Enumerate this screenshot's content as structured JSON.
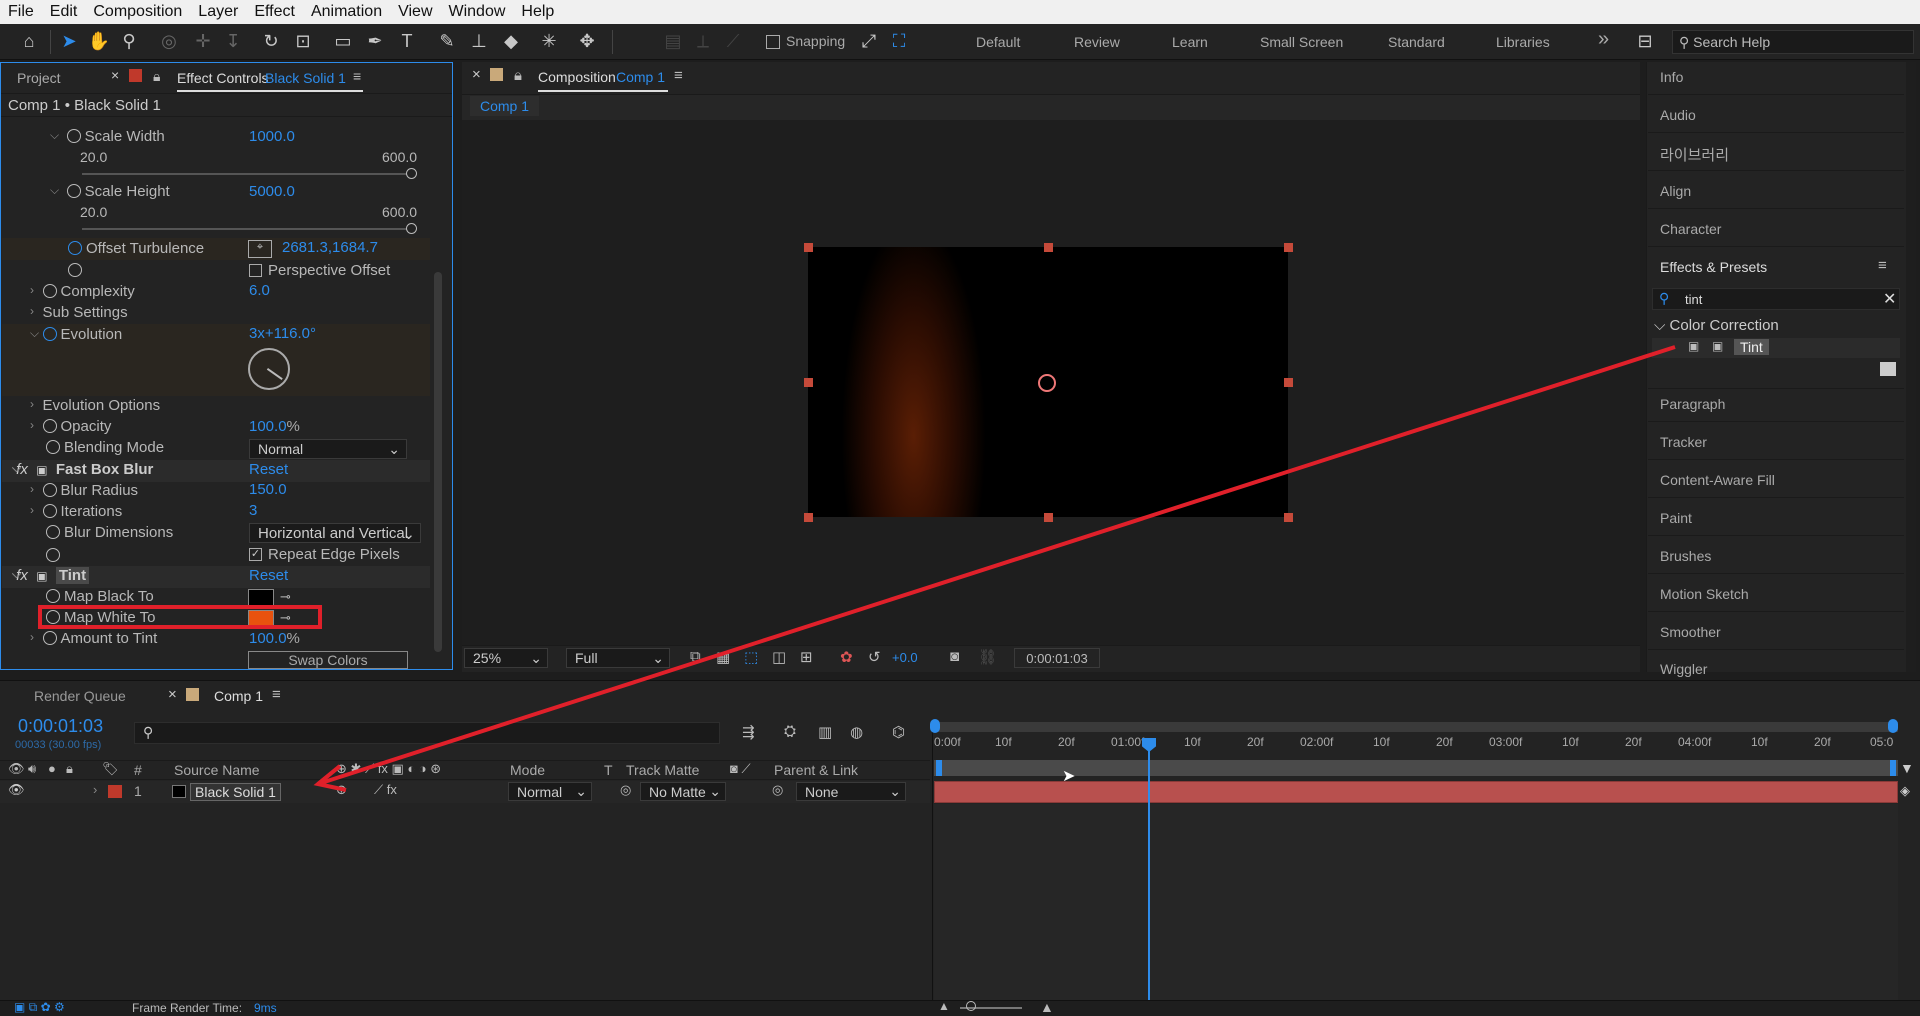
{
  "menu": [
    "File",
    "Edit",
    "Composition",
    "Layer",
    "Effect",
    "Animation",
    "View",
    "Window",
    "Help"
  ],
  "toolbar": {
    "snapping": "Snapping",
    "workspaces": [
      "Default",
      "Review",
      "Learn",
      "Small Screen",
      "Standard",
      "Libraries"
    ],
    "more": "»",
    "search_help": "Search Help"
  },
  "effect_controls": {
    "tab_project": "Project",
    "tab_label": "Effect Controls",
    "tab_layer": "Black Solid 1",
    "breadcrumb": "Comp 1 • Black Solid 1",
    "scale_width": {
      "label": "Scale Width",
      "value": "1000.0",
      "min": "20.0",
      "max": "600.0"
    },
    "scale_height": {
      "label": "Scale Height",
      "value": "5000.0",
      "min": "20.0",
      "max": "600.0"
    },
    "offset_turbulence": {
      "label": "Offset Turbulence",
      "value": "2681.3,1684.7"
    },
    "perspective_offset": "Perspective Offset",
    "complexity": {
      "label": "Complexity",
      "value": "6.0"
    },
    "sub_settings": "Sub Settings",
    "evolution": {
      "label": "Evolution",
      "value": "3x+116.0°"
    },
    "evolution_options": "Evolution Options",
    "opacity": {
      "label": "Opacity",
      "value": "100.0",
      "unit": "%"
    },
    "blending_mode": {
      "label": "Blending Mode",
      "value": "Normal"
    },
    "fast_box_blur": {
      "label": "Fast Box Blur",
      "reset": "Reset"
    },
    "blur_radius": {
      "label": "Blur Radius",
      "value": "150.0"
    },
    "iterations": {
      "label": "Iterations",
      "value": "3"
    },
    "blur_dimensions": {
      "label": "Blur Dimensions",
      "value": "Horizontal and Vertical"
    },
    "repeat_edge": "Repeat Edge Pixels",
    "tint": {
      "label": "Tint",
      "reset": "Reset"
    },
    "map_black": {
      "label": "Map Black To",
      "color": "#000000"
    },
    "map_white": {
      "label": "Map White To",
      "color": "#e8520e"
    },
    "amount_tint": {
      "label": "Amount to Tint",
      "value": "100.0",
      "unit": "%"
    },
    "swap_colors": "Swap Colors"
  },
  "composition": {
    "tab_label": "Composition",
    "comp_name": "Comp 1",
    "sub_tab": "Comp 1",
    "zoom": "25%",
    "quality": "Full",
    "exposure": "+0.0",
    "timecode": "0:00:01:03"
  },
  "right_panel": {
    "items_top": [
      "Info",
      "Audio",
      "라이브러리",
      "Align",
      "Character"
    ],
    "effects_presets": "Effects & Presets",
    "search_value": "tint",
    "category": "Color Correction",
    "effect_item": "Tint",
    "items_bottom": [
      "Paragraph",
      "Tracker",
      "Content-Aware Fill",
      "Paint",
      "Brushes",
      "Motion Sketch",
      "Smoother",
      "Wiggler"
    ]
  },
  "timeline": {
    "tab_render": "Render Queue",
    "tab_comp": "Comp 1",
    "timecode": "0:00:01:03",
    "frame_info": "00033 (30.00 fps)",
    "headers": {
      "num": "#",
      "source": "Source Name",
      "mode": "Mode",
      "t": "T",
      "track_matte": "Track Matte",
      "parent": "Parent & Link"
    },
    "layer": {
      "num": "1",
      "name": "Black Solid 1",
      "mode": "Normal",
      "matte": "No Matte",
      "parent": "None"
    },
    "ruler": [
      "0:00f",
      "10f",
      "20f",
      "01:00f",
      "10f",
      "20f",
      "02:00f",
      "10f",
      "20f",
      "03:00f",
      "10f",
      "20f",
      "04:00f",
      "10f",
      "20f",
      "05:0"
    ],
    "footer_label": "Frame Render Time:",
    "footer_value": "9ms"
  },
  "colors": {
    "accent": "#2d8ceb",
    "annotation": "#e0202a",
    "layer_bar": "#b8504e"
  }
}
